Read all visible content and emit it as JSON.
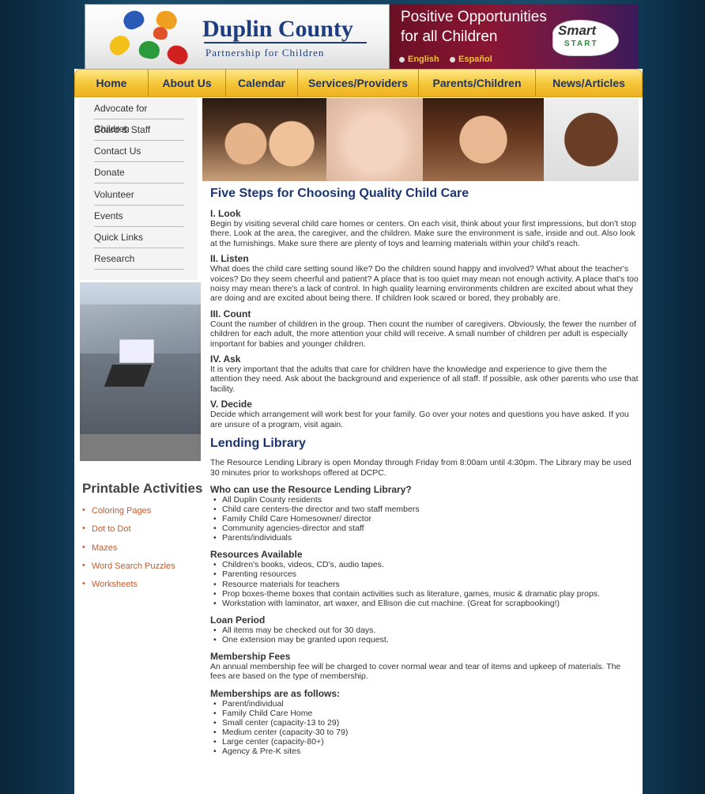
{
  "header": {
    "logo_title": "Duplin County",
    "logo_subtitle": "Partnership for Children",
    "tagline_1": "Positive Opportunities",
    "tagline_2": "for all Children",
    "badge_smart": "Smart",
    "badge_start": "START",
    "lang_english": "English",
    "lang_spanish": "Español",
    "colors": {
      "brand_blue": "#1d3d80",
      "nav_gold": "#f6c73a",
      "link_orange": "#c45b2a"
    }
  },
  "nav": {
    "items": [
      "Home",
      "About Us",
      "Calendar",
      "Services/Providers",
      "Parents/Children",
      "News/Articles"
    ]
  },
  "sidebar": {
    "items": [
      "Advocate for Children",
      "Board & Staff",
      "Contact Us",
      "Donate",
      "Volunteer",
      "Events",
      "Quick Links",
      "Research"
    ],
    "printable_title": "Printable Activities",
    "printable_items": [
      "Coloring Pages",
      "Dot to Dot",
      "Mazes",
      "Word Search Puzzles",
      "Worksheets"
    ]
  },
  "main": {
    "title": "Five Steps for Choosing Quality Child Care",
    "steps": [
      {
        "heading": "I. Look",
        "text": "Begin by visiting several child care homes or centers. On each visit, think about your first impressions, but don't stop there. Look at the area, the caregiver, and the children. Make sure the environment is safe, inside and out. Also look at the furnishings. Make sure there are plenty of toys and learning materials within your child's reach."
      },
      {
        "heading": "II. Listen",
        "text": "What does the child care setting sound like? Do the children sound happy and involved? What about the teacher's voices? Do they seem cheerful and patient? A place that is too quiet may mean not enough activity. A place that's too noisy may mean there's a lack of control. In high quality learning environments children are excited about what they are doing and are excited about being there. If children look scared or bored, they probably are."
      },
      {
        "heading": "III. Count",
        "text": "Count the number of children in the group. Then count the number of caregivers. Obviously, the fewer the number of children for each adult, the more attention your child will receive. A small number of children per adult is especially important for babies and younger children."
      },
      {
        "heading": "IV. Ask",
        "text": "It is very important that the adults that care for children have the knowledge and experience to give them the attention they need. Ask about the background and experience of all staff. If possible, ask other parents who use that facility."
      },
      {
        "heading": "V. Decide",
        "text": "Decide which arrangement will work best for your family. Go over your notes and questions you have asked. If you are unsure of a program, visit again."
      }
    ],
    "library_title": "Lending Library",
    "library_intro": "The Resource Lending Library is open Monday through Friday from 8:00am until 4:30pm. The Library may be used 30 minutes prior to workshops offered at DCPC.",
    "who_heading": "Who can use the Resource Lending Library?",
    "who_items": [
      "All Duplin County residents",
      "Child care centers-the director and two staff members",
      "Family Child Care Homesowner/ director",
      "Community agencies-director and staff",
      "Parents/individuals"
    ],
    "resources_heading": "Resources Available",
    "resources_items": [
      "Children's books, videos, CD's, audio tapes.",
      "Parenting resources",
      "Resource materials for teachers",
      "Prop boxes-theme boxes that contain activities such as literature, games, music & dramatic play props.",
      "Workstation with laminator, art waxer, and Ellison die cut machine. (Great for scrapbooking!)"
    ],
    "loan_heading": "Loan Period",
    "loan_items": [
      "All items may be checked out for 30 days.",
      "One extension may be granted upon request."
    ],
    "fees_heading": "Membership Fees",
    "fees_text": "An annual membership fee will be charged to cover normal wear and tear of items and upkeep of materials. The fees are based on the type of membership.",
    "memberships_heading": "Memberships are as follows:",
    "memberships_items": [
      "Parent/individual",
      "Family Child Care Home",
      "Small center (capacity-13 to 29)",
      "Medium center (capacity-30 to 79)",
      "Large center (capacity-80+)",
      "Agency & Pre-K sites"
    ]
  }
}
